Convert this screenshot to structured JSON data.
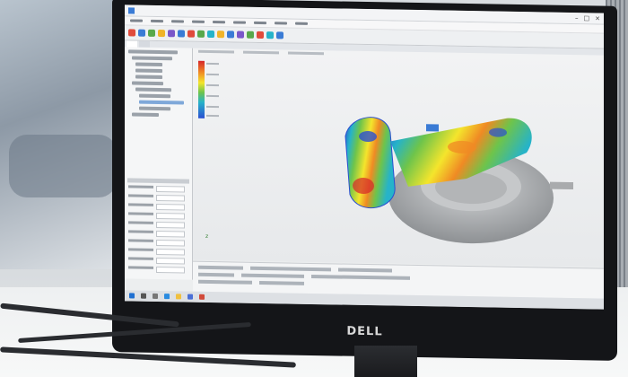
{
  "app": {
    "window_title": "",
    "menu_count": 9
  },
  "taskbar": {
    "clock": ""
  },
  "monitor": {
    "brand": "DELL"
  },
  "viewport": {
    "axis_label": "z"
  },
  "colors": {
    "legend_hot": "#d6262a",
    "legend_warm": "#f08a24",
    "legend_mid": "#f4e52c",
    "legend_green": "#6ec44b",
    "legend_cyan": "#26b3c9",
    "legend_cold": "#2a4fd1",
    "part_gray": "#a9abad"
  },
  "icons": {
    "titlebar": "app-icon",
    "window_controls": [
      "minimize-icon",
      "maximize-icon",
      "close-icon"
    ],
    "taskbar": [
      "windows-start-icon",
      "search-icon",
      "task-view-icon",
      "edge-icon",
      "folder-icon",
      "store-icon",
      "app-icon"
    ]
  }
}
